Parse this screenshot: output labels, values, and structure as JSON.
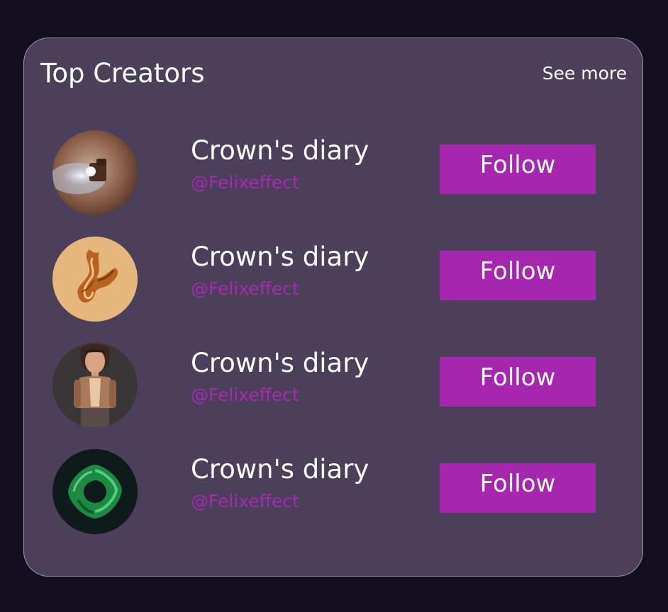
{
  "header": {
    "title": "Top Creators",
    "see_more": "See more"
  },
  "creators": [
    {
      "name": "Crown's diary",
      "handle": "@Felixeffect",
      "follow_label": "Follow",
      "avatar": "camera-light-avatar"
    },
    {
      "name": "Crown's diary",
      "handle": "@Felixeffect",
      "follow_label": "Follow",
      "avatar": "orange-swirl-avatar"
    },
    {
      "name": "Crown's diary",
      "handle": "@Felixeffect",
      "follow_label": "Follow",
      "avatar": "character-avatar"
    },
    {
      "name": "Crown's diary",
      "handle": "@Felixeffect",
      "follow_label": "Follow",
      "avatar": "green-torus-avatar"
    }
  ],
  "colors": {
    "page_background": "#140e21",
    "card_background": "#4b3f5a",
    "accent": "#a626b0",
    "handle_text": "#a62ab0"
  }
}
